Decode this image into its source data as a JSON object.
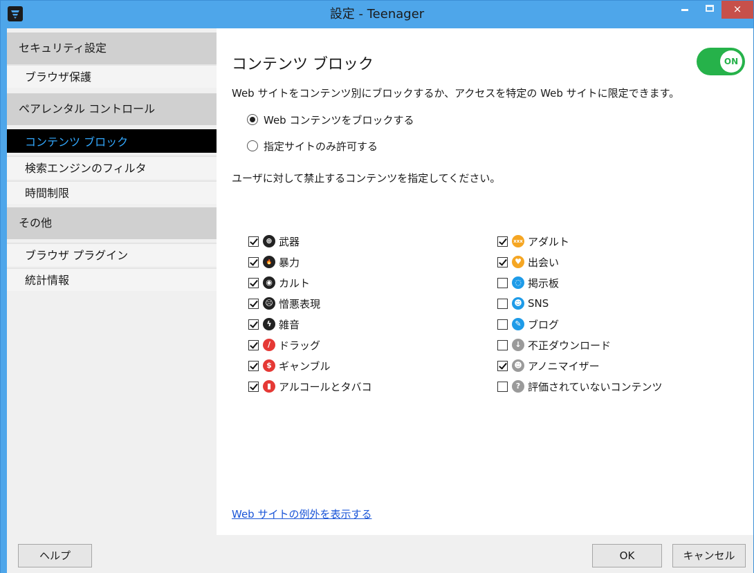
{
  "window": {
    "title": "設定 - Teenager",
    "minimize_label": "–",
    "maximize_label": "□",
    "close_label": "×"
  },
  "sidebar": {
    "sections": [
      {
        "label": "セキュリティ設定",
        "items": [
          {
            "label": "ブラウザ保護"
          }
        ]
      },
      {
        "label": "ペアレンタル コントロール",
        "items": [
          {
            "label": "コンテンツ ブロック",
            "active": true
          },
          {
            "label": "検索エンジンのフィルタ"
          },
          {
            "label": "時間制限"
          }
        ]
      },
      {
        "label": "その他",
        "items": [
          {
            "label": "ブラウザ プラグイン"
          },
          {
            "label": "統計情報"
          }
        ]
      }
    ]
  },
  "main": {
    "title": "コンテンツ ブロック",
    "toggle_label": "ON",
    "description": "Web サイトをコンテンツ別にブロックするか、アクセスを特定の Web サイトに限定できます。",
    "modes": [
      {
        "label": "Web コンテンツをブロックする",
        "selected": true
      },
      {
        "label": "指定サイトのみ許可する",
        "selected": false
      }
    ],
    "prompt": "ユーザに対して禁止するコンテンツを指定してください。",
    "categories_left": [
      {
        "label": "武器",
        "checked": true,
        "icon": "crosshair-icon",
        "color": "#222222",
        "glyph": "⊕"
      },
      {
        "label": "暴力",
        "checked": true,
        "icon": "fire-icon",
        "color": "#222222",
        "glyph": "🔥"
      },
      {
        "label": "カルト",
        "checked": true,
        "icon": "eye-icon",
        "color": "#222222",
        "glyph": "◉"
      },
      {
        "label": "憎悪表現",
        "checked": true,
        "icon": "angry-face-icon",
        "color": "#222222",
        "glyph": "☹"
      },
      {
        "label": "雑音",
        "checked": true,
        "icon": "lightning-icon",
        "color": "#222222",
        "glyph": "ϟ"
      },
      {
        "label": "ドラッグ",
        "checked": true,
        "icon": "pill-icon",
        "color": "#e53935",
        "glyph": "∕"
      },
      {
        "label": "ギャンブル",
        "checked": true,
        "icon": "dollar-icon",
        "color": "#e53935",
        "glyph": "$"
      },
      {
        "label": "アルコールとタバコ",
        "checked": true,
        "icon": "bottle-icon",
        "color": "#e53935",
        "glyph": "▮"
      }
    ],
    "categories_right": [
      {
        "label": "アダルト",
        "checked": true,
        "icon": "xxx-icon",
        "color": "#f5a623",
        "glyph": "xxx"
      },
      {
        "label": "出会い",
        "checked": true,
        "icon": "heart-icon",
        "color": "#f5a623",
        "glyph": "♥"
      },
      {
        "label": "掲示板",
        "checked": false,
        "icon": "chat-icon",
        "color": "#1e9be8",
        "glyph": "◌"
      },
      {
        "label": "SNS",
        "checked": false,
        "icon": "people-icon",
        "color": "#1e9be8",
        "glyph": "☻"
      },
      {
        "label": "ブログ",
        "checked": false,
        "icon": "pencil-icon",
        "color": "#1e9be8",
        "glyph": "✎"
      },
      {
        "label": "不正ダウンロード",
        "checked": false,
        "icon": "download-icon",
        "color": "#9a9a9a",
        "glyph": "↓"
      },
      {
        "label": "アノニマイザー",
        "checked": true,
        "icon": "anonymous-user-icon",
        "color": "#9a9a9a",
        "glyph": "☻"
      },
      {
        "label": "評価されていないコンテンツ",
        "checked": false,
        "icon": "question-icon",
        "color": "#9a9a9a",
        "glyph": "?"
      }
    ],
    "exceptions_link": "Web サイトの例外を表示する"
  },
  "footer": {
    "help_label": "ヘルプ",
    "ok_label": "OK",
    "cancel_label": "キャンセル"
  }
}
